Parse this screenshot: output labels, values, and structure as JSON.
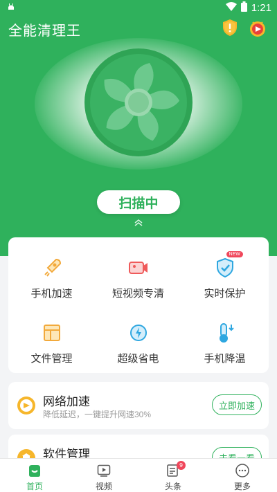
{
  "status_bar": {
    "time": "1:21"
  },
  "header": {
    "title": "全能清理王"
  },
  "scan": {
    "label": "扫描中"
  },
  "tools": [
    {
      "label": "手机加速",
      "icon": "rocket-icon"
    },
    {
      "label": "短视频专清",
      "icon": "video-camera-icon"
    },
    {
      "label": "实时保护",
      "icon": "shield-check-icon",
      "badge": "NEW"
    },
    {
      "label": "文件管理",
      "icon": "folder-icon"
    },
    {
      "label": "超级省电",
      "icon": "battery-saver-icon"
    },
    {
      "label": "手机降温",
      "icon": "thermometer-icon"
    }
  ],
  "cards": [
    {
      "title": "网络加速",
      "subtitle": "降低延迟，一键提升网速30%",
      "button": "立即加速",
      "icon": "network-speed-icon"
    },
    {
      "title": "软件管理",
      "subtitle": "",
      "button": "去看一看",
      "icon": "app-manager-icon"
    }
  ],
  "nav": [
    {
      "label": "首页",
      "icon": "home-icon",
      "active": true
    },
    {
      "label": "视频",
      "icon": "video-play-icon"
    },
    {
      "label": "头条",
      "icon": "news-icon",
      "badge": "9"
    },
    {
      "label": "更多",
      "icon": "more-icon"
    }
  ],
  "colors": {
    "brand": "#2fb15c",
    "badge": "#f0475b"
  }
}
